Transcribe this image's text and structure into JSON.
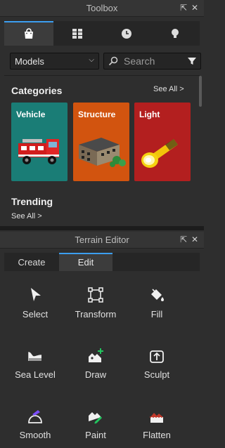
{
  "toolbox": {
    "title": "Toolbox",
    "tabs": [
      {
        "icon": "shopping-bag-icon"
      },
      {
        "icon": "grid-icon"
      },
      {
        "icon": "clock-icon"
      },
      {
        "icon": "lightbulb-icon"
      }
    ],
    "filter": {
      "selected": "Models"
    },
    "search": {
      "placeholder": "Search"
    },
    "categories": {
      "title": "Categories",
      "see_all": "See All >",
      "items": [
        {
          "label": "Vehicle",
          "color": "#1a7d76",
          "icon": "fire-truck-icon"
        },
        {
          "label": "Structure",
          "color": "#d2540f",
          "icon": "building-icon"
        },
        {
          "label": "Light",
          "color": "#b31f1f",
          "icon": "flashlight-icon"
        }
      ]
    },
    "trending": {
      "title": "Trending",
      "see_all": "See All >"
    }
  },
  "terrain_editor": {
    "title": "Terrain Editor",
    "tabs": [
      {
        "label": "Create"
      },
      {
        "label": "Edit",
        "active": true
      }
    ],
    "tools": [
      {
        "label": "Select",
        "icon": "cursor-arrow-icon"
      },
      {
        "label": "Transform",
        "icon": "transform-icon"
      },
      {
        "label": "Fill",
        "icon": "paint-bucket-icon"
      },
      {
        "label": "Sea Level",
        "icon": "sea-level-icon"
      },
      {
        "label": "Draw",
        "icon": "draw-terrain-icon"
      },
      {
        "label": "Sculpt",
        "icon": "sculpt-icon"
      },
      {
        "label": "Smooth",
        "icon": "smooth-icon"
      },
      {
        "label": "Paint",
        "icon": "paint-terrain-icon"
      },
      {
        "label": "Flatten",
        "icon": "flatten-icon"
      }
    ]
  },
  "colors": {
    "accent": "#3c9ef0",
    "panel": "#2e2e2e",
    "green": "#22c55e",
    "purple": "#7c4dff",
    "flatten_red": "#c0392b"
  }
}
